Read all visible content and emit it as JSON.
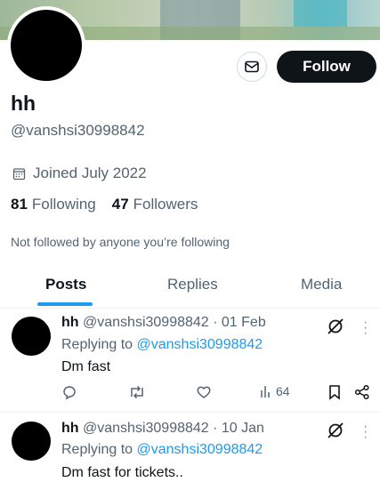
{
  "profile": {
    "name": "hh",
    "handle": "@vanshsi30998842",
    "joined": "Joined July 2022",
    "following_count": "81",
    "following_label": "Following",
    "followers_count": "47",
    "followers_label": "Followers",
    "not_followed_text": "Not followed by anyone you’re following",
    "follow_label": "Follow"
  },
  "tabs": [
    {
      "label": "Posts",
      "active": true
    },
    {
      "label": "Replies",
      "active": false
    },
    {
      "label": "Media",
      "active": false
    }
  ],
  "posts": [
    {
      "name": "hh",
      "meta": "@vanshsi30998842 · 01 Feb",
      "replying_prefix": "Replying to",
      "replying_handle": "@vanshsi30998842",
      "text": "Dm fast",
      "views": "64"
    },
    {
      "name": "hh",
      "meta": "@vanshsi30998842 · 10 Jan",
      "replying_prefix": "Replying to",
      "replying_handle": "@vanshsi30998842",
      "text": "Dm fast for tickets.."
    }
  ],
  "colors": {
    "accent": "#1d9bf0",
    "text": "#0f1419",
    "muted": "#536471"
  }
}
